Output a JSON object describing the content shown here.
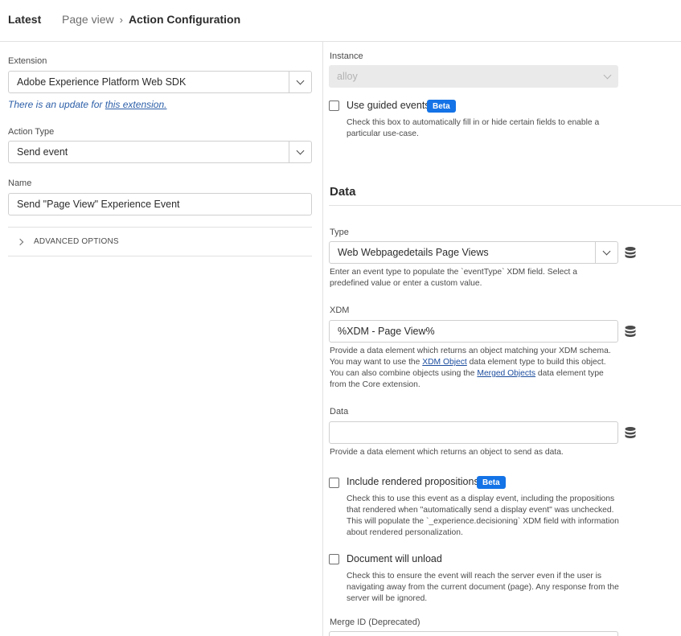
{
  "header": {
    "latest": "Latest",
    "breadcrumb": [
      "Page view",
      "Action Configuration"
    ],
    "separator": "›"
  },
  "left": {
    "extension_label": "Extension",
    "extension_value": "Adobe Experience Platform Web SDK",
    "update_text": "There is an update for ",
    "update_link": "this extension.",
    "action_type_label": "Action Type",
    "action_type_value": "Send event",
    "name_label": "Name",
    "name_value": "Send \"Page View\" Experience Event",
    "advanced_options": "ADVANCED OPTIONS"
  },
  "right": {
    "instance_label": "Instance",
    "instance_value": "alloy",
    "guided_label": "Use guided events",
    "guided_badge": "Beta",
    "guided_help": "Check this box to automatically fill in or hide certain fields to enable a particular use-case.",
    "data_section": "Data",
    "type_label": "Type",
    "type_value": "Web Webpagedetails Page Views",
    "type_help": "Enter an event type to populate the `eventType` XDM field. Select a predefined value or enter a custom value.",
    "xdm_label": "XDM",
    "xdm_value": "%XDM - Page View%",
    "xdm_help_1": "Provide a data element which returns an object matching your XDM schema. You may want to use the ",
    "xdm_help_link1": "XDM Object",
    "xdm_help_2": " data element type to build this object. You can also combine objects using the ",
    "xdm_help_link2": "Merged Objects",
    "xdm_help_3": " data element type from the Core extension.",
    "data_label": "Data",
    "data_value": "",
    "data_help": "Provide a data element which returns an object to send as data.",
    "rendered_label": "Include rendered propositions",
    "rendered_badge": "Beta",
    "rendered_help": "Check this to use this event as a display event, including the propositions that rendered when \"automatically send a display event\" was unchecked. This will populate the `_experience.decisioning` XDM field with information about rendered personalization.",
    "unload_label": "Document will unload",
    "unload_help": "Check this to ensure the event will reach the server even if the user is navigating away from the current document (page). Any response from the server will be ignored.",
    "merge_label": "Merge ID (Deprecated)"
  },
  "colors": {
    "accent": "#1473e6",
    "link": "#2c5fa8"
  },
  "icons": {
    "data_element": "database-icon",
    "dropdown": "chevron-down-icon",
    "expand": "chevron-right-icon"
  }
}
